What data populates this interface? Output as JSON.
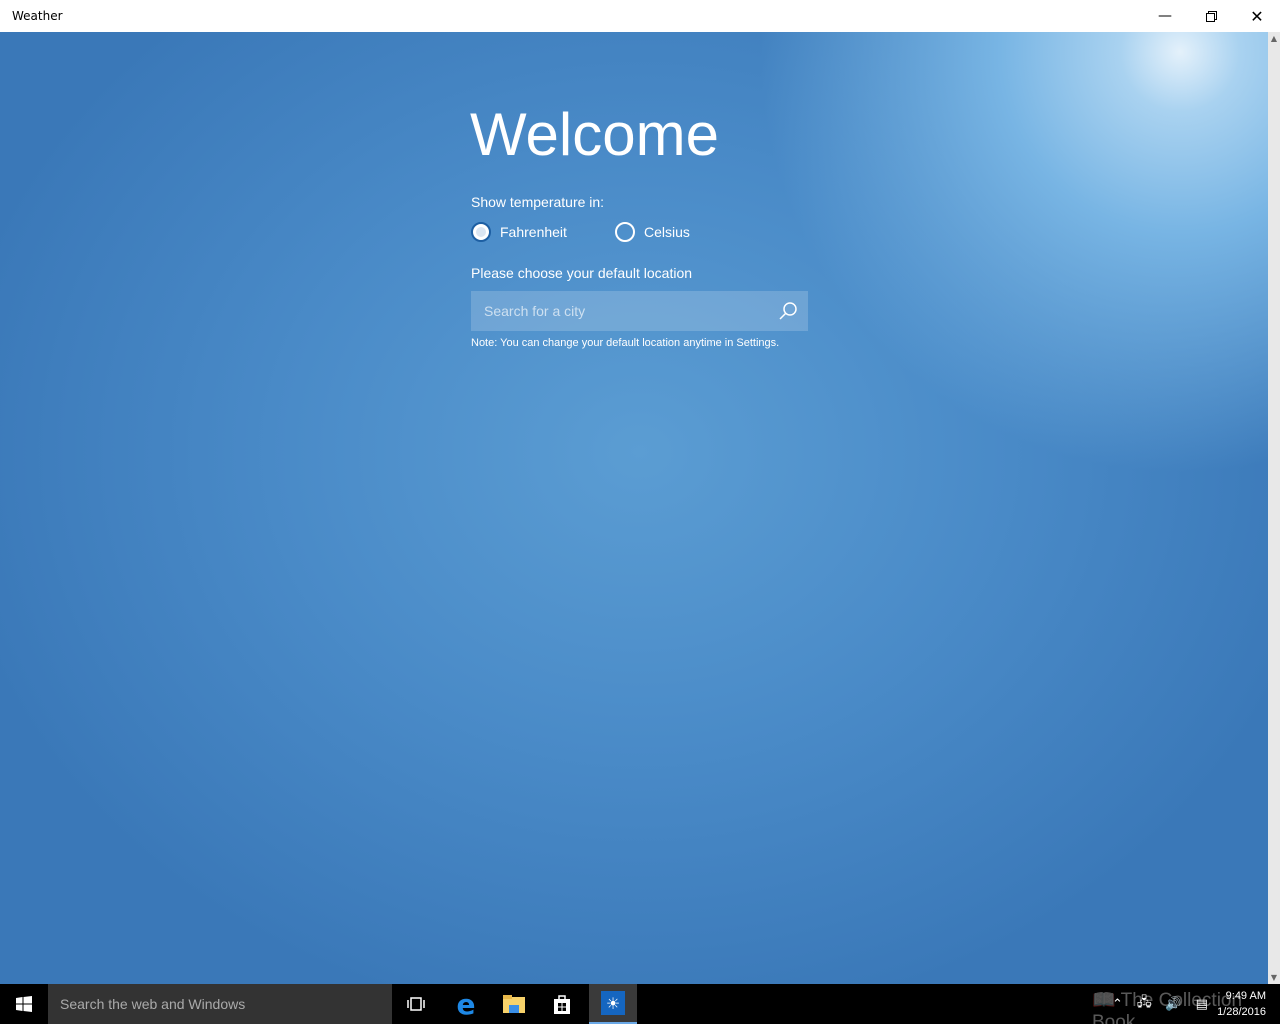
{
  "window": {
    "title": "Weather"
  },
  "welcome": {
    "heading": "Welcome",
    "temp_label": "Show temperature in:",
    "options": [
      {
        "label": "Fahrenheit",
        "selected": true
      },
      {
        "label": "Celsius",
        "selected": false
      }
    ],
    "location_label": "Please choose your default location",
    "search_placeholder": "Search for a city",
    "note": "Note: You can change your default location anytime in Settings."
  },
  "taskbar": {
    "search_placeholder": "Search the web and Windows",
    "time": "9:49 AM",
    "date": "1/28/2016"
  },
  "watermark": "The Collection Book"
}
